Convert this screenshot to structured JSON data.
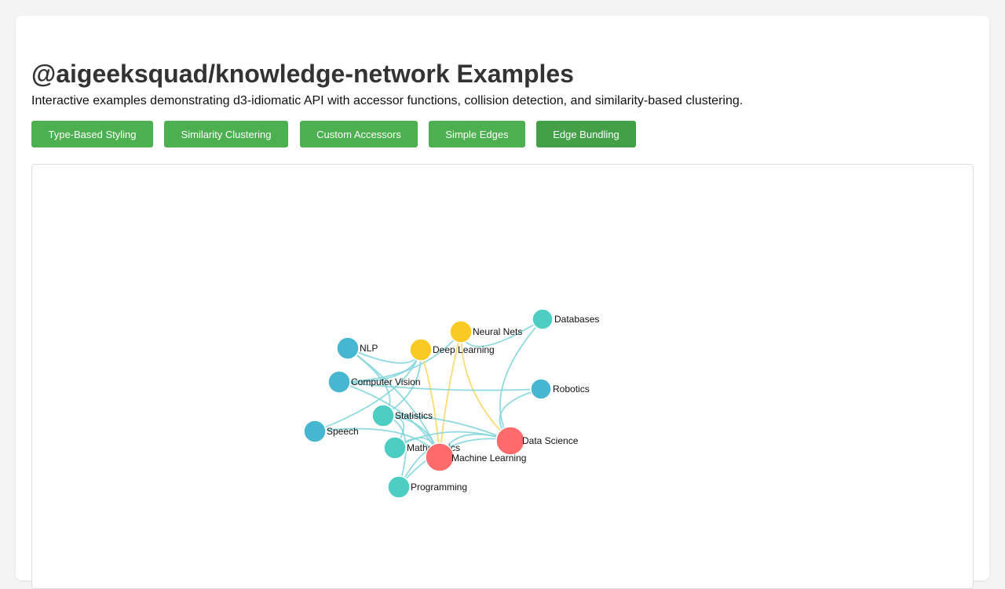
{
  "page": {
    "title": "@aigeeksquad/knowledge-network Examples",
    "description": "Interactive examples demonstrating d3-idiomatic API with accessor functions, collision detection, and similarity-based clustering."
  },
  "buttons": [
    {
      "label": "Type-Based Styling",
      "active": false
    },
    {
      "label": "Similarity Clustering",
      "active": false
    },
    {
      "label": "Custom Accessors",
      "active": false
    },
    {
      "label": "Simple Edges",
      "active": false
    },
    {
      "label": "Edge Bundling",
      "active": true
    }
  ],
  "colors": {
    "button": "#4caf50",
    "button_active": "#43a047",
    "core": "#ff6b6b",
    "technique": "#f9ca24",
    "foundation": "#4ecdc4",
    "application": "#45b7d1",
    "edge_teal": "#7fd3dc",
    "edge_yellow": "#f9d65c"
  },
  "network": {
    "nodes": [
      {
        "id": "databases",
        "label": "Databases",
        "group": "foundation"
      },
      {
        "id": "neural-nets",
        "label": "Neural Nets",
        "group": "technique"
      },
      {
        "id": "nlp",
        "label": "NLP",
        "group": "application"
      },
      {
        "id": "deep-learning",
        "label": "Deep Learning",
        "group": "technique"
      },
      {
        "id": "computer-vision",
        "label": "Computer Vision",
        "group": "application"
      },
      {
        "id": "robotics",
        "label": "Robotics",
        "group": "application"
      },
      {
        "id": "statistics",
        "label": "Statistics",
        "group": "foundation"
      },
      {
        "id": "speech",
        "label": "Speech",
        "group": "application"
      },
      {
        "id": "data-science",
        "label": "Data Science",
        "group": "core"
      },
      {
        "id": "mathematics",
        "label": "Mathematics",
        "group": "foundation"
      },
      {
        "id": "machine-learning",
        "label": "Machine Learning",
        "group": "core"
      },
      {
        "id": "programming",
        "label": "Programming",
        "group": "foundation"
      }
    ],
    "edges": [
      {
        "source": "neural-nets",
        "target": "databases"
      },
      {
        "source": "neural-nets",
        "target": "machine-learning"
      },
      {
        "source": "neural-nets",
        "target": "data-science"
      },
      {
        "source": "neural-nets",
        "target": "computer-vision"
      },
      {
        "source": "deep-learning",
        "target": "machine-learning"
      },
      {
        "source": "deep-learning",
        "target": "nlp"
      },
      {
        "source": "deep-learning",
        "target": "computer-vision"
      },
      {
        "source": "deep-learning",
        "target": "speech"
      },
      {
        "source": "deep-learning",
        "target": "statistics"
      },
      {
        "source": "nlp",
        "target": "statistics"
      },
      {
        "source": "nlp",
        "target": "machine-learning"
      },
      {
        "source": "computer-vision",
        "target": "machine-learning"
      },
      {
        "source": "computer-vision",
        "target": "robotics"
      },
      {
        "source": "robotics",
        "target": "data-science"
      },
      {
        "source": "databases",
        "target": "data-science"
      },
      {
        "source": "statistics",
        "target": "data-science"
      },
      {
        "source": "statistics",
        "target": "machine-learning"
      },
      {
        "source": "speech",
        "target": "machine-learning"
      },
      {
        "source": "mathematics",
        "target": "machine-learning"
      },
      {
        "source": "mathematics",
        "target": "statistics"
      },
      {
        "source": "mathematics",
        "target": "data-science"
      },
      {
        "source": "programming",
        "target": "machine-learning"
      },
      {
        "source": "programming",
        "target": "data-science"
      },
      {
        "source": "programming",
        "target": "statistics"
      },
      {
        "source": "machine-learning",
        "target": "data-science"
      }
    ]
  }
}
